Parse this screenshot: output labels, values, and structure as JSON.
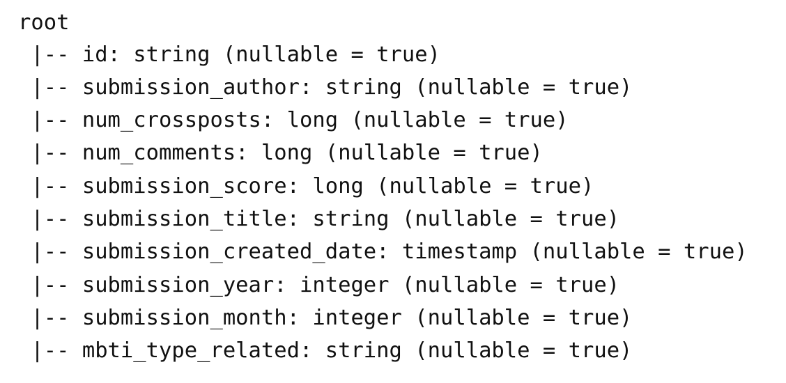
{
  "schema": {
    "root_label": "root",
    "prefix": " |-- ",
    "fields": [
      "id: string (nullable = true)",
      "submission_author: string (nullable = true)",
      "num_crossposts: long (nullable = true)",
      "num_comments: long (nullable = true)",
      "submission_score: long (nullable = true)",
      "submission_title: string (nullable = true)",
      "submission_created_date: timestamp (nullable = true)",
      "submission_year: integer (nullable = true)",
      "submission_month: integer (nullable = true)",
      "mbti_type_related: string (nullable = true)"
    ]
  }
}
